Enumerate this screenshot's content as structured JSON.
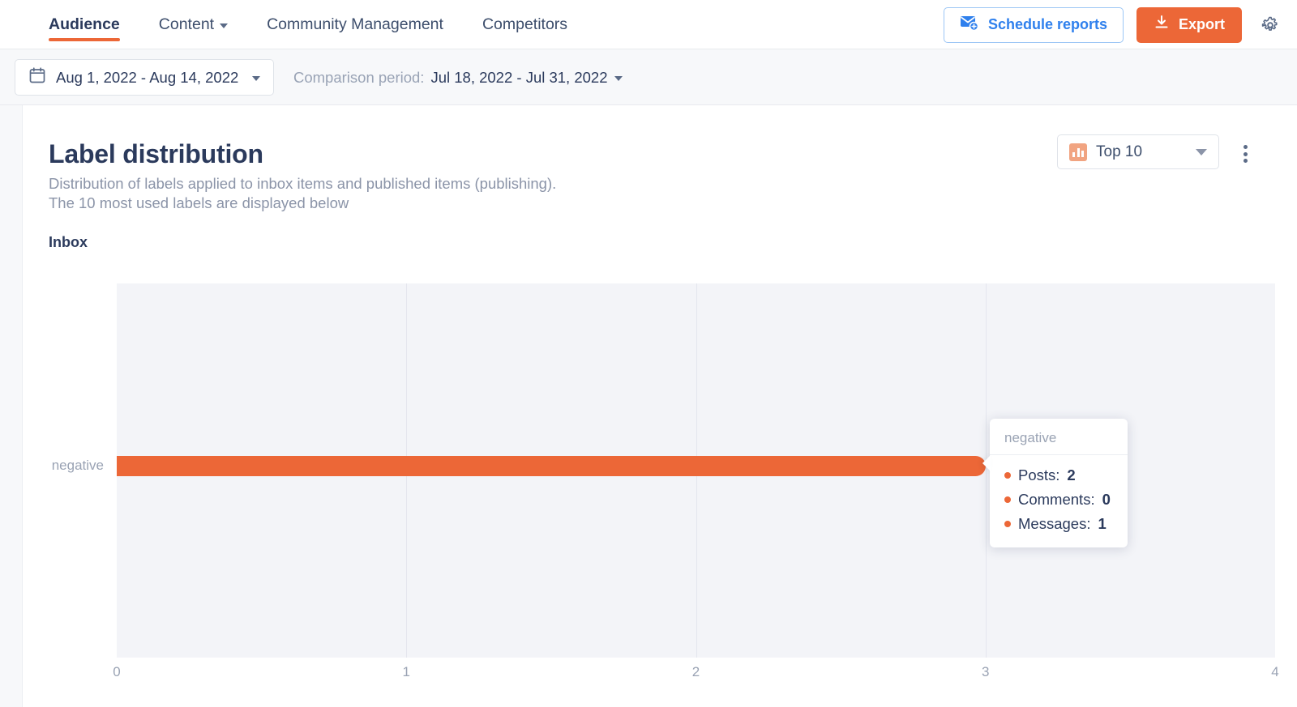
{
  "nav": {
    "items": [
      {
        "label": "Audience",
        "active": true,
        "has_caret": false
      },
      {
        "label": "Content",
        "active": false,
        "has_caret": true
      },
      {
        "label": "Community Management",
        "active": false,
        "has_caret": false
      },
      {
        "label": "Competitors",
        "active": false,
        "has_caret": false
      }
    ],
    "schedule_reports_label": "Schedule reports",
    "export_label": "Export",
    "gear_icon": "gear-icon",
    "accent_color": "#ec6737",
    "link_color": "#2f80ed"
  },
  "filters": {
    "date_range": "Aug 1, 2022 - Aug 14, 2022",
    "calendar_icon": "calendar-icon",
    "comparison_prefix": "Comparison period:",
    "comparison_value": "Jul 18, 2022 - Jul 31, 2022"
  },
  "card": {
    "title": "Label distribution",
    "subtitle": "Distribution of labels applied to inbox items and published items (publishing).\nThe 10 most used labels are displayed below",
    "section_label": "Inbox",
    "top_selector": {
      "label": "Top 10",
      "icon": "bar-chart-icon"
    },
    "more_menu_icon": "kebab-menu-icon"
  },
  "tooltip": {
    "title": "negative",
    "rows": [
      {
        "label": "Posts:",
        "value": "2"
      },
      {
        "label": "Comments:",
        "value": "0"
      },
      {
        "label": "Messages:",
        "value": "1"
      }
    ]
  },
  "chart_data": {
    "type": "bar",
    "orientation": "horizontal",
    "title": "Inbox",
    "categories": [
      "negative"
    ],
    "values": [
      3
    ],
    "series": [
      {
        "name": "Posts",
        "values": [
          2
        ],
        "color": "#ec6737"
      },
      {
        "name": "Comments",
        "values": [
          0
        ],
        "color": "#ec6737"
      },
      {
        "name": "Messages",
        "values": [
          1
        ],
        "color": "#ec6737"
      }
    ],
    "xlabel": "",
    "ylabel": "",
    "xticks": [
      "0",
      "1",
      "2",
      "3",
      "4"
    ],
    "xlim": [
      0,
      4
    ],
    "grid": true,
    "legend": "none",
    "bar_color": "#ec6737",
    "plot_background": "#f3f4f8"
  }
}
